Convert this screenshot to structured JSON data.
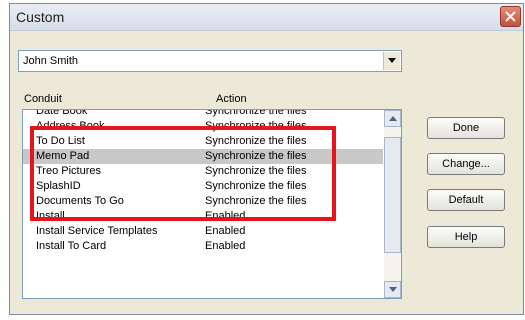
{
  "window": {
    "title": "Custom"
  },
  "user_select": {
    "selected": "John Smith"
  },
  "columns": {
    "conduit": "Conduit",
    "action": "Action"
  },
  "rows": [
    {
      "conduit": "Date Book",
      "action": "Synchronize the files"
    },
    {
      "conduit": "Address Book",
      "action": "Synchronize the files"
    },
    {
      "conduit": "To Do List",
      "action": "Synchronize the files"
    },
    {
      "conduit": "Memo Pad",
      "action": "Synchronize the files"
    },
    {
      "conduit": "Treo Pictures",
      "action": "Synchronize the files"
    },
    {
      "conduit": "SplashID",
      "action": "Synchronize the files"
    },
    {
      "conduit": "Documents To Go",
      "action": "Synchronize the files"
    },
    {
      "conduit": "Install",
      "action": "Enabled"
    },
    {
      "conduit": "Install Service Templates",
      "action": "Enabled"
    },
    {
      "conduit": "Install To Card",
      "action": "Enabled"
    }
  ],
  "selected_row_index": 3,
  "buttons": {
    "done": "Done",
    "change": "Change...",
    "default": "Default",
    "help": "Help"
  },
  "colors": {
    "highlight": "#e8141c",
    "dialog_bg": "#ece9d8",
    "selected_row": "#c8c8c8"
  },
  "icons": {
    "close": "close-icon",
    "dropdown": "chevron-down-icon",
    "scroll_up": "scroll-up-arrow-icon",
    "scroll_down": "scroll-down-arrow-icon"
  }
}
